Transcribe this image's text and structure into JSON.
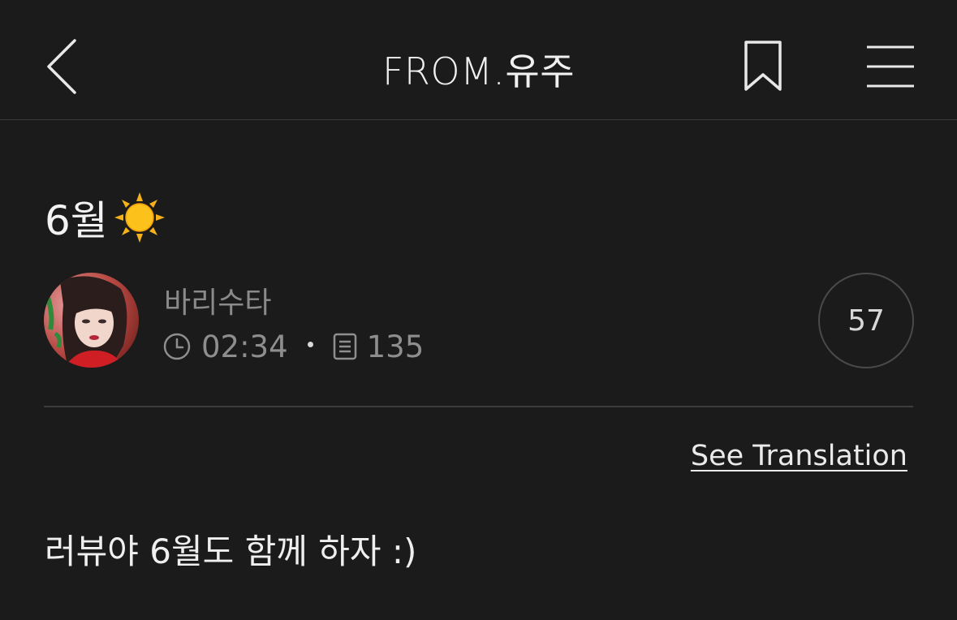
{
  "header": {
    "title": "FROM.유주",
    "back_icon": "chevron-left-icon",
    "bookmark_icon": "bookmark-icon",
    "menu_icon": "hamburger-menu-icon"
  },
  "post": {
    "title": "6월",
    "title_emoji": "sun-icon",
    "author": "바리수타",
    "time": "02:34",
    "count": "135",
    "comments": "57",
    "see_translation": "See Translation",
    "body": "러뷰야 6월도 함께 하자 :)"
  },
  "colors": {
    "background": "#1b1b1b",
    "text": "#f2f2f2",
    "muted": "#8a8a8a",
    "divider": "#3d3d3d"
  }
}
